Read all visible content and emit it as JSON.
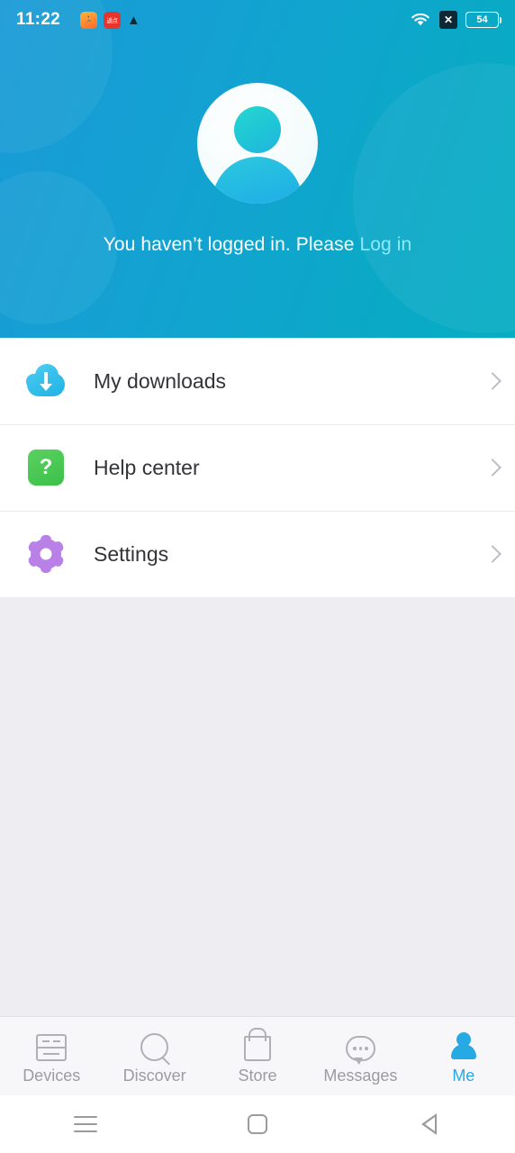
{
  "statusbar": {
    "time": "11:22",
    "notif_icons": [
      "fitness-app-icon",
      "red-app-icon",
      "warning-triangle-icon"
    ],
    "app2_label": "返点",
    "warning_glyph": "▲",
    "wifi_icon": "wifi-icon",
    "x_badge": "✕",
    "battery_level": "54"
  },
  "header": {
    "avatar_icon": "default-avatar-icon",
    "login_prompt": "You haven’t logged in. Please ",
    "login_link": "Log in",
    "gradient_from": "#1a9ad6",
    "gradient_to": "#06adc2"
  },
  "menu": {
    "items": [
      {
        "label": "My downloads",
        "icon": "cloud-download-icon",
        "color": "#22b6e6"
      },
      {
        "label": "Help center",
        "icon": "help-question-icon",
        "color": "#3cc04a",
        "glyph": "?"
      },
      {
        "label": "Settings",
        "icon": "gear-icon",
        "color": "#b981e8"
      }
    ]
  },
  "tabbar": {
    "active_color": "#27a9e3",
    "inactive_color": "#9b9ba1",
    "tabs": [
      {
        "label": "Devices",
        "icon": "devices-icon",
        "active": false
      },
      {
        "label": "Discover",
        "icon": "search-icon",
        "active": false
      },
      {
        "label": "Store",
        "icon": "shopping-bag-icon",
        "active": false
      },
      {
        "label": "Messages",
        "icon": "speech-bubble-icon",
        "active": false
      },
      {
        "label": "Me",
        "icon": "person-icon",
        "active": true
      }
    ]
  },
  "navbar": {
    "recents_icon": "menu-icon",
    "home_icon": "home-square-icon",
    "back_icon": "back-triangle-icon"
  }
}
